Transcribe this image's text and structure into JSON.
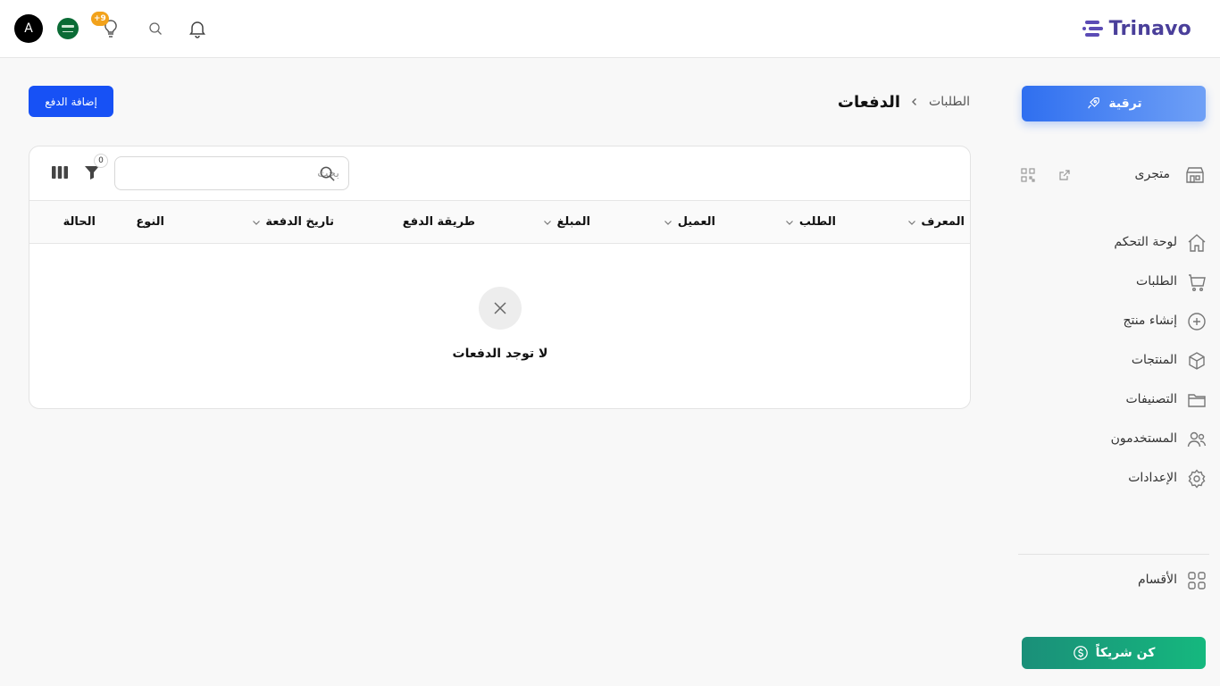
{
  "app": {
    "brand": "Trinavo"
  },
  "topbar": {
    "avatar_letter": "A",
    "lightbulb_badge": "+9"
  },
  "sidebar": {
    "upgrade_label": "ترقية",
    "store_label": "متجرى",
    "items": [
      {
        "label": "لوحة التحكم",
        "icon": "home-icon"
      },
      {
        "label": "الطلبات",
        "icon": "cart-icon"
      },
      {
        "label": "إنشاء منتج",
        "icon": "plus-circle-icon"
      },
      {
        "label": "المنتجات",
        "icon": "box-icon"
      },
      {
        "label": "التصنيفات",
        "icon": "folder-icon"
      },
      {
        "label": "المستخدمون",
        "icon": "users-icon"
      },
      {
        "label": "الإعدادات",
        "icon": "gear-icon"
      }
    ],
    "sections_label": "الأقسام",
    "partner_label": "كن شريكاً"
  },
  "page": {
    "breadcrumb_parent": "الطلبات",
    "title": "الدفعات",
    "add_payment_label": "إضافة الدفع"
  },
  "table": {
    "search_placeholder": "بحث",
    "filter_count": "0",
    "columns": [
      "المعرف",
      "الطلب",
      "العميل",
      "المبلغ",
      "طريقة الدفع",
      "تاريخ الدفعة",
      "النوع",
      "الحالة"
    ],
    "empty_message": "لا توجد الدفعات"
  },
  "colors": {
    "primary": "#1751f5",
    "brand": "#4a3f9a",
    "partner": "#15b87e",
    "badge": "#f2a21b"
  }
}
